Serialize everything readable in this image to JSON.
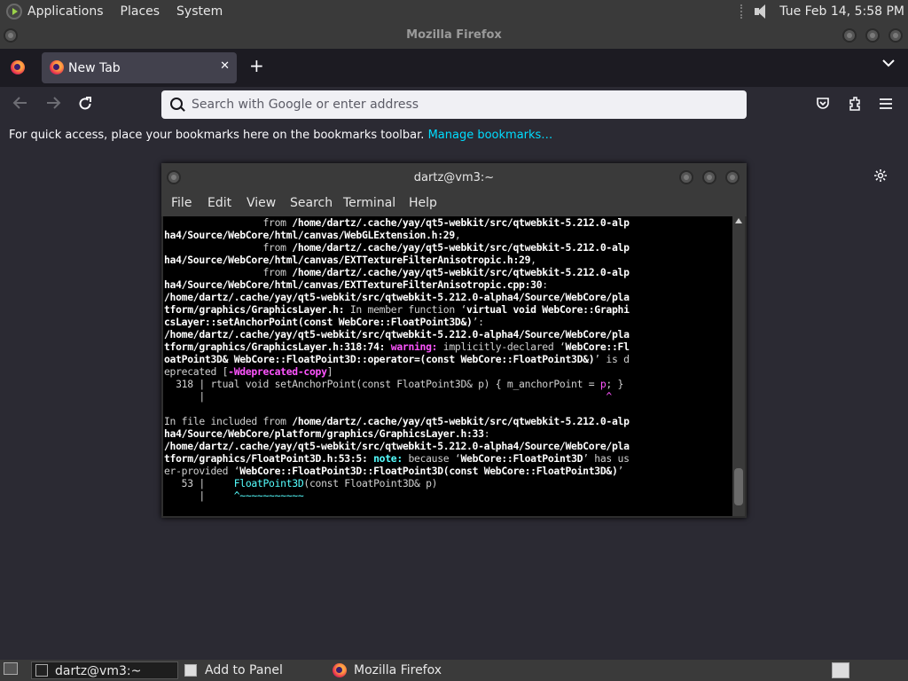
{
  "top_panel": {
    "menus": [
      "Applications",
      "Places",
      "System"
    ],
    "clock": "Tue Feb 14,  5:58 PM"
  },
  "firefox": {
    "window_title": "Mozilla Firefox",
    "tab": {
      "label": "New Tab",
      "close": "✕"
    },
    "new_tab": "+",
    "list_all_tabs": "⌄",
    "urlbar_placeholder": "Search with Google or enter address",
    "bookmarks_text": "For quick access, place your bookmarks here on the bookmarks toolbar.",
    "manage_bookmarks": "Manage bookmarks…"
  },
  "terminal": {
    "title": "dartz@vm3:~",
    "menu": [
      "File",
      "Edit",
      "View",
      "Search",
      "Terminal",
      "Help"
    ]
  },
  "taskbar": {
    "items": [
      "dartz@vm3:~",
      "Add to Panel",
      "Mozilla Firefox"
    ]
  },
  "colors": {
    "firefox_bg": "#2b2a33",
    "tabstrip": "#1c1b22",
    "accent_link": "#00ddff",
    "panel": "#3a3a3a",
    "terminal_bg": "#000000"
  }
}
